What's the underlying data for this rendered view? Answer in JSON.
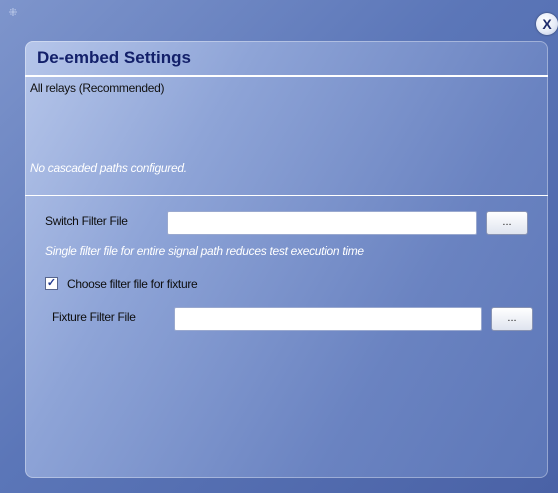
{
  "window": {
    "close_label": "X"
  },
  "dialog": {
    "title": "De-embed Settings",
    "subtitle": "All relays (Recommended)",
    "no_paths_note": "No cascaded paths configured."
  },
  "switch_filter": {
    "label": "Switch Filter File",
    "value": "",
    "browse_label": "...",
    "hint": "Single filter file for entire signal path reduces test execution time"
  },
  "fixture_checkbox": {
    "label": "Choose filter file for fixture",
    "checked": true,
    "check_glyph": "✓"
  },
  "fixture_filter": {
    "label": "Fixture Filter File",
    "value": "",
    "browse_label": "..."
  },
  "icons": {
    "grip": "grip-icon",
    "close": "close-icon",
    "check": "checkmark-icon"
  },
  "colors": {
    "title_text": "#13206a",
    "panel_light": "#b6c6ea",
    "panel_dark": "#5d77b8",
    "frame": "#5b76b8"
  }
}
